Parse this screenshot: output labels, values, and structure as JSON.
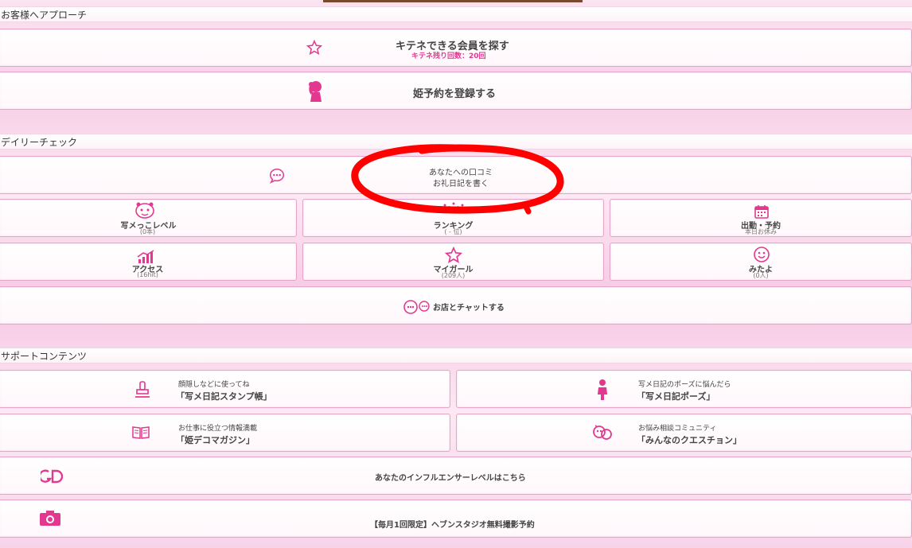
{
  "approach": {
    "header": "お客様へアプローチ",
    "kitene": {
      "title": "キテネできる会員を探す",
      "sub": "キテネ残り回数：20回"
    },
    "hime": {
      "title": "姫予約を登録する"
    }
  },
  "daily": {
    "header": "デイリーチェック",
    "kuchikomi": {
      "line1": "あなたへの口コミ",
      "line2": "お礼日記を書く"
    },
    "grid": [
      {
        "label": "写メっこレベル",
        "sub": "(0本)"
      },
      {
        "label": "ランキング",
        "sub": "( - 位)"
      },
      {
        "label": "出勤・予約",
        "sub": "本日お休み"
      },
      {
        "label": "アクセス",
        "sub": "(16hit)"
      },
      {
        "label": "マイガール",
        "sub": "(209人)"
      },
      {
        "label": "みたよ",
        "sub": "(0人)"
      }
    ],
    "chat": {
      "label": "お店とチャットする"
    }
  },
  "support": {
    "header": "サポートコンテンツ",
    "items": [
      {
        "line1": "顔隠しなどに使ってね",
        "line2": "「写メ日記スタンプ帳」"
      },
      {
        "line1": "写メ日記のポーズに悩んだら",
        "line2": "「写メ日記ポーズ」"
      },
      {
        "line1": "お仕事に役立つ情報満載",
        "line2": "「姫デコマガジン」"
      },
      {
        "line1": "お悩み相談コミュニティ",
        "line2": "「みんなのクエスチョン」"
      }
    ],
    "influencer": {
      "label": "あなたのインフルエンサーレベルはこちら"
    },
    "studio": {
      "label": "【毎月1回限定】ヘブンスタジオ無料撮影予約"
    }
  },
  "colors": {
    "accent": "#e2388f",
    "border": "#e3a6c8",
    "annotation": "#ff0000"
  },
  "annotation": {
    "shape": "red-hand-drawn-ellipse"
  }
}
